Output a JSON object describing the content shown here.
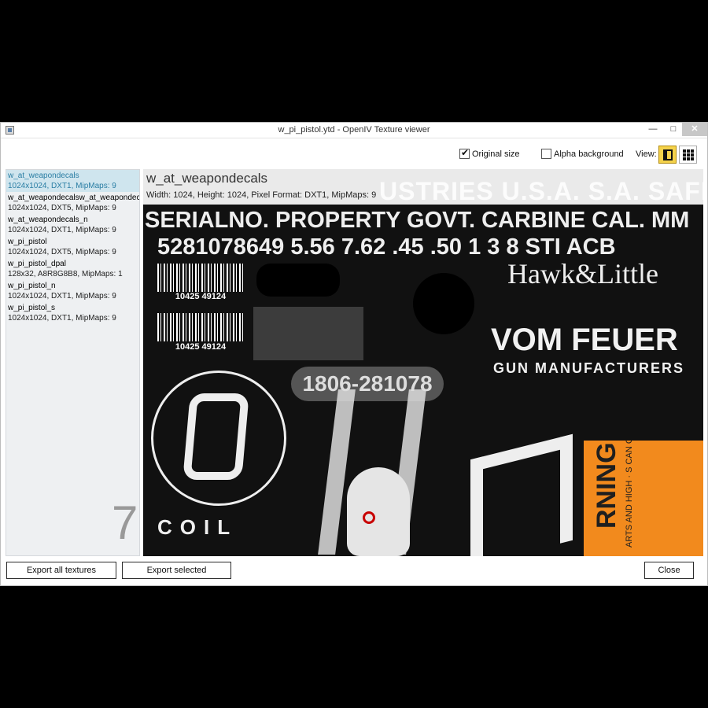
{
  "window": {
    "title": "w_pi_pistol.ytd - OpenIV Texture viewer",
    "min": "—",
    "max": "□",
    "close": "✕"
  },
  "toolbar": {
    "original_size": "Original size",
    "alpha_background": "Alpha background",
    "view_label": "View:"
  },
  "textures": [
    {
      "name": "w_at_weapondecals",
      "meta": "1024x1024, DXT1, MipMaps: 9"
    },
    {
      "name": "w_at_weapondecalsw_at_weapondec",
      "meta": "1024x1024, DXT5, MipMaps: 9"
    },
    {
      "name": "w_at_weapondecals_n",
      "meta": "1024x1024, DXT1, MipMaps: 9"
    },
    {
      "name": "w_pi_pistol",
      "meta": "1024x1024, DXT5, MipMaps: 9"
    },
    {
      "name": "w_pi_pistol_dpal",
      "meta": "128x32, A8R8G8B8, MipMaps: 1"
    },
    {
      "name": "w_pi_pistol_n",
      "meta": "1024x1024, DXT1, MipMaps: 9"
    },
    {
      "name": "w_pi_pistol_s",
      "meta": "1024x1024, DXT1, MipMaps: 9"
    }
  ],
  "preview": {
    "name": "w_at_weapondecals",
    "meta": "Width: 1024, Height: 1024, Pixel Format: DXT1, MipMaps: 9",
    "background_text": "USTRIES U.S.A. S.A. SAFE SEMI FULL",
    "serial_line": "SERIALNO. PROPERTY GOVT. CARBINE CAL. MM",
    "number_line": "5281078649 5.56 7.62 .45 .50 1 3 8 STI ACB",
    "barcode_1": "10425  49124",
    "barcode_2": "10425  49124",
    "pill": "1806-281078",
    "hawk": "Hawk&Little",
    "vom": "VOM FEUER",
    "gun": "GUN MANUFACTURERS",
    "coil": "COIL",
    "warning": "RNING",
    "warning_fine": "ARTS AND HIGH · S CAN CAUSE · URY. REFER TO · AL FOR SAFETY.",
    "ghost": "7"
  },
  "buttons": {
    "export_all": "Export all textures",
    "export_selected": "Export selected",
    "close": "Close"
  }
}
